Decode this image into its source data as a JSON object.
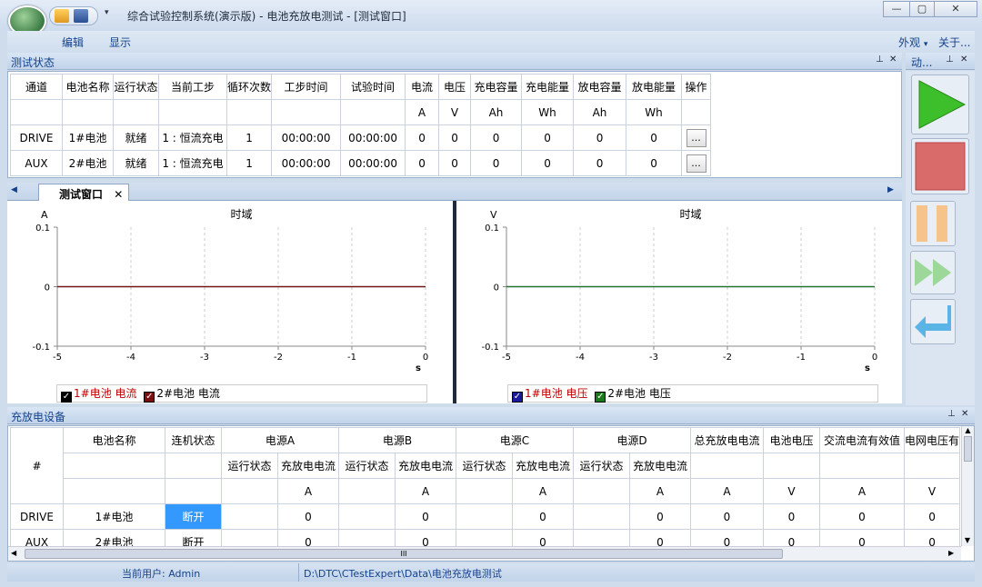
{
  "window": {
    "title": "综合试验控制系统(演示版) - 电池充放电测试 - [测试窗口]",
    "colors": {
      "accent": "#15428b",
      "chrome": "#cfdcec",
      "selected_cell": "#3399ff"
    }
  },
  "menu": {
    "edit": "编辑",
    "view": "显示",
    "appearance": "外观",
    "about": "关于..."
  },
  "status_panel": {
    "title": "测试状态",
    "headers": [
      "通道",
      "电池名称",
      "运行状态",
      "当前工步",
      "循环次数",
      "工步时间",
      "试验时间",
      "电流",
      "电压",
      "充电容量",
      "充电能量",
      "放电容量",
      "放电能量",
      "操作"
    ],
    "units": [
      "",
      "",
      "",
      "",
      "",
      "",
      "",
      "A",
      "V",
      "Ah",
      "Wh",
      "Ah",
      "Wh",
      ""
    ],
    "rows": [
      [
        "DRIVE",
        "1#电池",
        "就绪",
        "1 : 恒流充电",
        "1",
        "00:00:00",
        "00:00:00",
        "0",
        "0",
        "0",
        "0",
        "0",
        "0",
        "..."
      ],
      [
        "AUX",
        "2#电池",
        "就绪",
        "1 : 恒流充电",
        "1",
        "00:00:00",
        "00:00:00",
        "0",
        "0",
        "0",
        "0",
        "0",
        "0",
        "..."
      ]
    ]
  },
  "tabs": {
    "active": "测试窗口"
  },
  "charts_text": {
    "left": {
      "unit": "A",
      "title": "时域",
      "xunit": "s",
      "legend": [
        "1#电池 电流",
        "2#电池 电流"
      ]
    },
    "right": {
      "unit": "V",
      "title": "时域",
      "xunit": "s",
      "legend": [
        "1#电池 电压",
        "2#电池 电压"
      ]
    }
  },
  "chart_data": [
    {
      "type": "line",
      "title": "时域",
      "ylabel": "A",
      "xlabel": "s",
      "xlim": [
        -5,
        0
      ],
      "ylim": [
        -0.1,
        0.1
      ],
      "x_ticks": [
        "-5",
        "-4",
        "-3",
        "-2",
        "-1",
        "0"
      ],
      "y_ticks": [
        "0.1",
        "0",
        "-0.1"
      ],
      "series": [
        {
          "name": "1#电池 电流",
          "color": "#000000",
          "x": [
            -5,
            0
          ],
          "y": [
            0,
            0
          ]
        },
        {
          "name": "2#电池 电流",
          "color": "#7a1010",
          "x": [
            -5,
            0
          ],
          "y": [
            0,
            0
          ]
        }
      ],
      "legend": "bottom",
      "grid": true
    },
    {
      "type": "line",
      "title": "时域",
      "ylabel": "V",
      "xlabel": "s",
      "xlim": [
        -5,
        0
      ],
      "ylim": [
        -0.1,
        0.1
      ],
      "x_ticks": [
        "-5",
        "-4",
        "-3",
        "-2",
        "-1",
        "0"
      ],
      "y_ticks": [
        "0.1",
        "0",
        "-0.1"
      ],
      "series": [
        {
          "name": "1#电池 电压",
          "color": "#1a1aa0",
          "x": [
            -5,
            0
          ],
          "y": [
            0,
            0
          ]
        },
        {
          "name": "2#电池 电压",
          "color": "#1a7a1a",
          "x": [
            -5,
            0
          ],
          "y": [
            0,
            0
          ]
        }
      ],
      "legend": "bottom",
      "grid": true
    }
  ],
  "side": {
    "title": "动..."
  },
  "device_panel": {
    "title": "充放电设备",
    "hash": "#",
    "top_headers": [
      "电池名称",
      "连机状态",
      "电源A",
      "电源B",
      "电源C",
      "电源D",
      "总充放电电流",
      "电池电压",
      "交流电流有效值",
      "电网电压有"
    ],
    "sub_headers": [
      "运行状态",
      "充放电电流",
      "运行状态",
      "充放电电流",
      "运行状态",
      "充放电电流",
      "运行状态",
      "充放电电流"
    ],
    "units": [
      "A",
      "A",
      "A",
      "A",
      "A",
      "V",
      "A",
      "V"
    ],
    "rows": [
      {
        "ch": "DRIVE",
        "name": "1#电池",
        "link": "断开",
        "a": "0",
        "b": "0",
        "c": "0",
        "d": "0",
        "total": "0",
        "volt": "0",
        "ac": "0",
        "grid": "0"
      },
      {
        "ch": "AUX",
        "name": "2#电池",
        "link": "断开",
        "a": "0",
        "b": "0",
        "c": "0",
        "d": "0",
        "total": "0",
        "volt": "0",
        "ac": "0",
        "grid": "0"
      }
    ],
    "scroll_label": "III"
  },
  "statusbar": {
    "user": "当前用户: Admin",
    "path": "D:\\DTC\\CTestExpert\\Data\\电池充放电测试"
  }
}
